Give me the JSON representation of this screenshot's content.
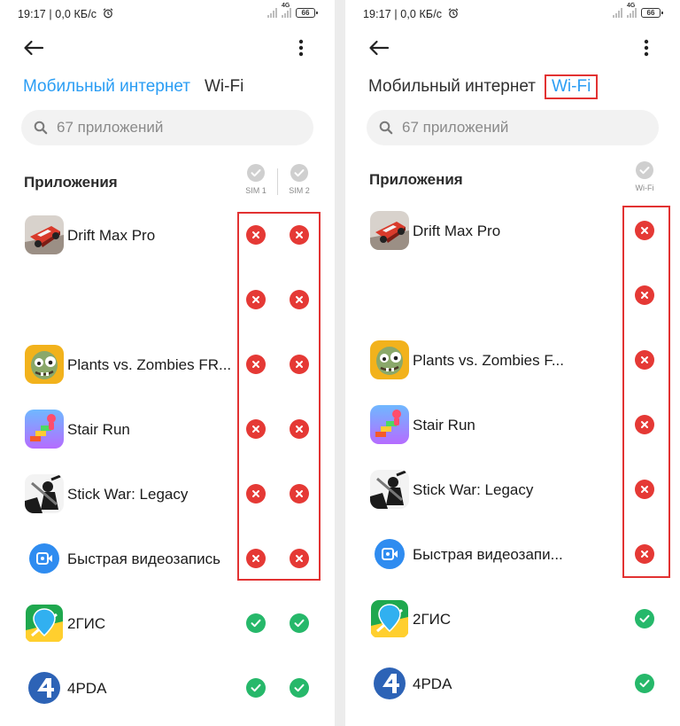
{
  "status_bar": {
    "time_speed": "19:17 | 0,0 КБ/с",
    "network": "4G",
    "battery": "66"
  },
  "tabs": [
    "Мобильный интернет",
    "Wi-Fi"
  ],
  "search_placeholder": "67 приложений",
  "section_title": "Приложения",
  "left_screen": {
    "active_tab": "Мобильный интернет",
    "columns": [
      "SIM 1",
      "SIM 2"
    ]
  },
  "right_screen": {
    "active_tab": "Wi-Fi",
    "columns": [
      "Wi-Fi"
    ]
  },
  "apps_left": [
    {
      "name": "Drift Max Pro",
      "icon": "drift-max-pro-icon",
      "allowed": false
    },
    {
      "name": "",
      "icon": "",
      "allowed": false
    },
    {
      "name": "Plants vs. Zombies FR...",
      "icon": "plants-vs-zombies-icon",
      "allowed": false
    },
    {
      "name": "Stair Run",
      "icon": "stair-run-icon",
      "allowed": false
    },
    {
      "name": "Stick War: Legacy",
      "icon": "stick-war-icon",
      "allowed": false
    },
    {
      "name": "Быстрая видеозапись",
      "icon": "quick-video-icon",
      "allowed": false
    },
    {
      "name": "2ГИС",
      "icon": "2gis-icon",
      "allowed": true
    },
    {
      "name": "4PDA",
      "icon": "4pda-icon",
      "allowed": true
    }
  ],
  "apps_right": [
    {
      "name": "Drift Max Pro",
      "icon": "drift-max-pro-icon",
      "allowed": false
    },
    {
      "name": "",
      "icon": "",
      "allowed": false
    },
    {
      "name": "Plants vs. Zombies F...",
      "icon": "plants-vs-zombies-icon",
      "allowed": false
    },
    {
      "name": "Stair Run",
      "icon": "stair-run-icon",
      "allowed": false
    },
    {
      "name": "Stick War: Legacy",
      "icon": "stick-war-icon",
      "allowed": false
    },
    {
      "name": "Быстрая видеозапи...",
      "icon": "quick-video-icon",
      "allowed": false
    },
    {
      "name": "2ГИС",
      "icon": "2gis-icon",
      "allowed": true
    },
    {
      "name": "4PDA",
      "icon": "4pda-icon",
      "allowed": true
    }
  ],
  "colors": {
    "accent": "#2a9df4",
    "blocked": "#e53935",
    "allowed": "#26b86a",
    "highlight": "#e23232"
  }
}
